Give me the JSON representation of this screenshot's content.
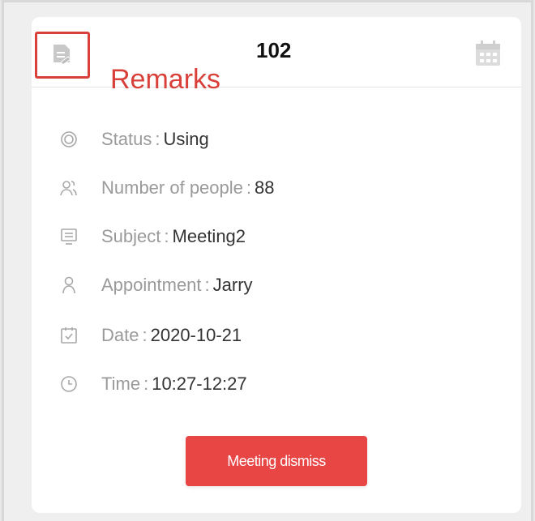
{
  "header": {
    "annotation_label": "Remarks",
    "room_number": "102",
    "accent_color": "#d9403a"
  },
  "info": [
    {
      "icon": "status-icon",
      "label": "Status",
      "sep": ":",
      "value": "Using"
    },
    {
      "icon": "people-icon",
      "label": "Number of people",
      "sep": ":",
      "value": "88"
    },
    {
      "icon": "subject-icon",
      "label": "Subject",
      "sep": ":",
      "value": "Meeting2"
    },
    {
      "icon": "user-icon",
      "label": "Appointment",
      "sep": ":",
      "value": "Jarry"
    },
    {
      "icon": "date-icon",
      "label": "Date",
      "sep": ":",
      "value": "2020-10-21"
    },
    {
      "icon": "clock-icon",
      "label": "Time",
      "sep": ":",
      "value": "10:27-12:27"
    }
  ],
  "actions": {
    "dismiss_label": "Meeting dismiss",
    "dismiss_color": "#e84545"
  }
}
